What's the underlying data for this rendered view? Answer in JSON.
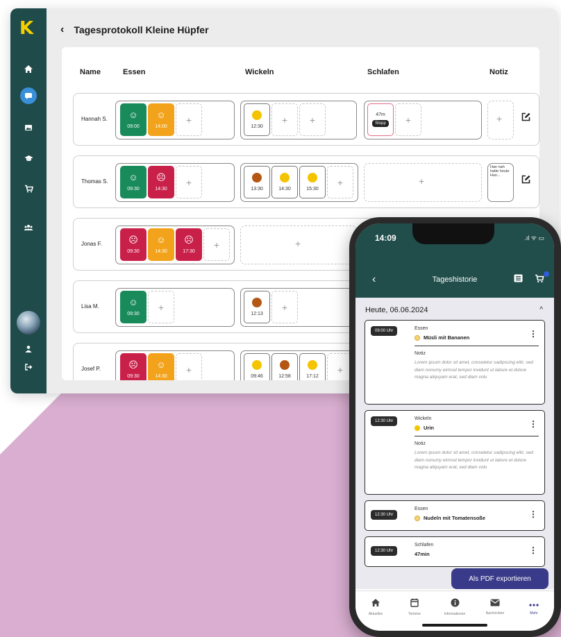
{
  "colors": {
    "sidebar_bg": "#1f4b4a",
    "logo_yellow": "#f5d000",
    "mood_good": "#198a5a",
    "mood_neutral": "#f2a31b",
    "mood_bad": "#c9204a",
    "diaper_yellow": "#f5c400",
    "diaper_brown": "#b55714",
    "phone_header": "#214d4b",
    "export_button": "#3a3a8a",
    "background_shape": "#d9aed0"
  },
  "desktop": {
    "logo": "K",
    "sidebar_icons": [
      "home-icon",
      "chat-icon",
      "image-icon",
      "education-icon",
      "cart-icon",
      "group-icon",
      "user-icon",
      "logout-icon"
    ],
    "back_icon": "‹",
    "title": "Tagesprotokoll Kleine Hüpfer",
    "columns": {
      "name": "Name",
      "essen": "Essen",
      "wickeln": "Wickeln",
      "schlafen": "Schlafen",
      "notiz": "Notiz"
    },
    "rows": [
      {
        "name": "Hannah S.",
        "essen": [
          {
            "mood": "good",
            "time": "09:00"
          },
          {
            "mood": "neutral",
            "time": "14:00"
          }
        ],
        "wickeln": [
          {
            "type": "yellow",
            "time": "12:30"
          }
        ],
        "schlafen": {
          "duration": "47m",
          "action": "Stopp"
        },
        "note": ""
      },
      {
        "name": "Thomas S.",
        "essen": [
          {
            "mood": "good",
            "time": "09:30"
          },
          {
            "mood": "bad",
            "time": "14:30"
          }
        ],
        "wickeln": [
          {
            "type": "brown",
            "time": "13:30"
          },
          {
            "type": "yellow",
            "time": "14:30"
          },
          {
            "type": "yellow",
            "time": "15:30"
          }
        ],
        "note": "Han nah hatte heute Hun..."
      },
      {
        "name": "Jonas F.",
        "essen": [
          {
            "mood": "bad",
            "time": "09:30"
          },
          {
            "mood": "neutral",
            "time": "14:30"
          },
          {
            "mood": "bad",
            "time": "17:30"
          }
        ]
      },
      {
        "name": "Lisa M.",
        "essen": [
          {
            "mood": "good",
            "time": "09:30"
          }
        ],
        "wickeln": [
          {
            "type": "brown",
            "time": "12:13"
          }
        ]
      },
      {
        "name": "Josef P.",
        "essen": [
          {
            "mood": "bad",
            "time": "09:30"
          },
          {
            "mood": "neutral",
            "time": "14:30"
          }
        ],
        "wickeln": [
          {
            "type": "yellow",
            "time": "09:46"
          },
          {
            "type": "brown",
            "time": "12:58"
          },
          {
            "type": "yellow",
            "time": "17:12"
          }
        ]
      }
    ],
    "add_symbol": "+"
  },
  "phone": {
    "status_time": "14:09",
    "status_icons": ".ıl ᯤ ▭",
    "back_icon": "‹",
    "title": "Tageshistorie",
    "date": "Heute, 06.06.2024",
    "date_chevron": "^",
    "entries": [
      {
        "time": "09:00 Uhr",
        "category": "Essen",
        "item": "Müsli mit Bananen",
        "dot": "pale",
        "note_label": "Notiz",
        "note": "Lorem ipsum dolor sit amet, consetetur sadipscing elitr, sed diam nonumy eirmod tempor invidunt ut labore et dolore magna aliquyam erat, sed diam volu"
      },
      {
        "time": "12:30 Uhr",
        "category": "Wickeln",
        "item": "Urin",
        "dot": "yellow",
        "note_label": "Notiz",
        "note": "Lorem ipsum dolor sit amet, consetetur sadipscing elitr, sed diam nonumy eirmod tempor invidunt ut labore et dolore magna aliquyam erat, sed diam volu"
      },
      {
        "time": "12:30 Uhr",
        "category": "Essen",
        "item": "Nudeln mit Tomatensoße",
        "dot": "pale"
      },
      {
        "time": "12:30 Uhr",
        "category": "Schlafen",
        "item": "47min"
      }
    ],
    "menu_dots": "⋮",
    "export_button": "Als PDF exportieren",
    "tabs": [
      {
        "label": "Aktuelles",
        "icon": "house-icon"
      },
      {
        "label": "Termine",
        "icon": "calendar-icon"
      },
      {
        "label": "Informationen",
        "icon": "info-icon"
      },
      {
        "label": "Nachrichten",
        "icon": "mail-icon"
      },
      {
        "label": "Mehr",
        "icon": "more-icon"
      }
    ]
  }
}
